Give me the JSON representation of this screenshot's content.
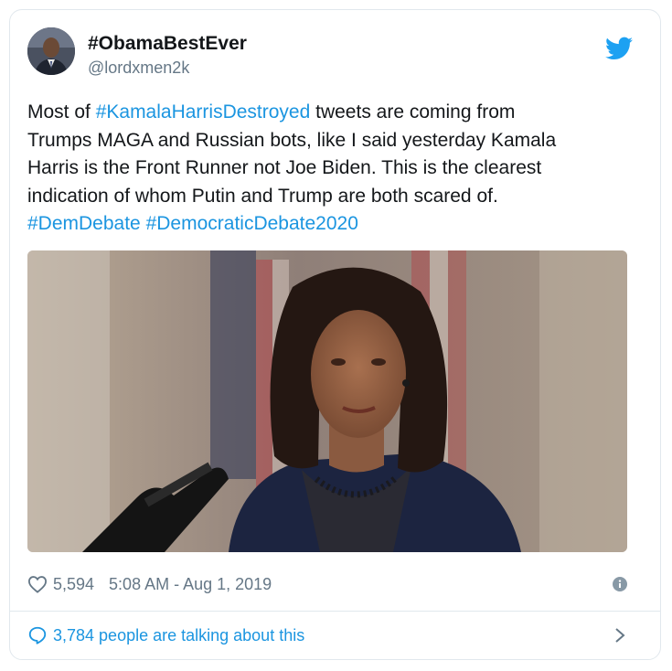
{
  "tweet": {
    "display_name": "#ObamaBestEver",
    "handle": "@lordxmen2k",
    "text_lines": [
      [
        {
          "t": "Most of ",
          "tag": false
        },
        {
          "t": "#KamalaHarrisDestroyed",
          "tag": true
        },
        {
          "t": " tweets are coming from",
          "tag": false
        }
      ],
      [
        {
          "t": "Trumps MAGA and Russian bots, like I said yesterday Kamala",
          "tag": false
        }
      ],
      [
        {
          "t": "Harris is the Front Runner not Joe Biden. This is the clearest",
          "tag": false
        }
      ],
      [
        {
          "t": "indication of whom Putin and Trump are both scared of.",
          "tag": false
        }
      ],
      [
        {
          "t": "#DemDebate",
          "tag": true
        },
        {
          "t": " ",
          "tag": false
        },
        {
          "t": "#DemocraticDebate2020",
          "tag": true
        }
      ]
    ],
    "like_count": "5,594",
    "timestamp": "5:08 AM - Aug 1, 2019",
    "talking_text": "3,784 people are talking about this"
  },
  "icons": {
    "brand": "twitter-bird-icon",
    "like": "heart-icon",
    "info": "info-icon",
    "reply": "speech-bubble-icon",
    "more": "chevron-right-icon"
  },
  "colors": {
    "link": "#1b95e0",
    "text": "#14171a",
    "muted": "#657786",
    "border": "#e1e8ed",
    "twitter_blue": "#1da1f2"
  }
}
